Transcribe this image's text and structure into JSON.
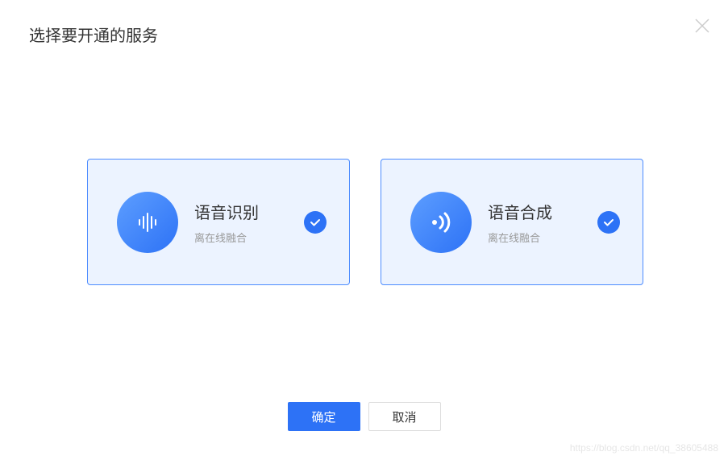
{
  "dialog": {
    "title": "选择要开通的服务"
  },
  "services": [
    {
      "title": "语音识别",
      "subtitle": "离在线融合",
      "selected": true
    },
    {
      "title": "语音合成",
      "subtitle": "离在线融合",
      "selected": true
    }
  ],
  "buttons": {
    "confirm": "确定",
    "cancel": "取消"
  },
  "watermark": "https://blog.csdn.net/qq_38605488"
}
